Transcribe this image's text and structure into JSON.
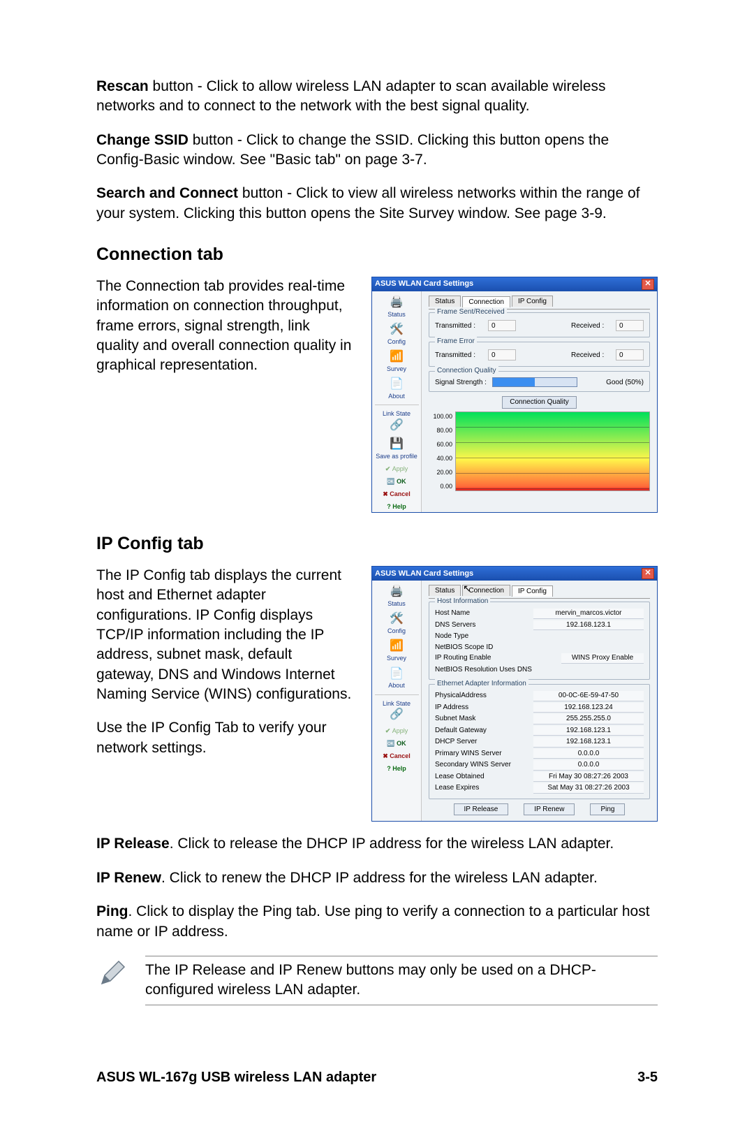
{
  "body": {
    "p1_bold": "Rescan",
    "p1_rest": " button - Click to allow wireless LAN adapter to scan available wireless networks and to connect to the network with the best signal quality.",
    "p2_bold": "Change SSID",
    "p2_rest": " button - Click to change the SSID. Clicking this button opens the Config-Basic window. See \"Basic tab\" on page 3-7.",
    "p3_bold": "Search and Connect",
    "p3_rest": " button - Click to view all wireless networks within the range of your system. Clicking this button opens the Site Survey window. See page 3-9.",
    "h_conn": "Connection tab",
    "conn_para": "The Connection tab provides real-time information on connection throughput, frame errors, signal strength, link quality and overall connection quality in graphical representation.",
    "h_ip": "IP Config tab",
    "ip_para1": "The IP Config tab displays the current host and Ethernet adapter configurations. IP Config displays TCP/IP information including the IP address, subnet mask, default gateway, DNS and Windows Internet Naming Service (WINS) configurations.",
    "ip_para2": "Use the IP Config Tab to verify your network settings.",
    "iprel_bold": "IP Release",
    "iprel_rest": ". Click to release the DHCP IP address for the wireless LAN adapter.",
    "ipren_bold": "IP Renew",
    "ipren_rest": ". Click to renew the DHCP IP address for the wireless LAN adapter.",
    "ping_bold": "Ping",
    "ping_rest": ". Click to display the Ping tab. Use ping to verify a connection to a particular host name or IP address.",
    "note": "The IP Release and IP Renew buttons may only be used on a DHCP-configured wireless LAN adapter."
  },
  "dialog_common": {
    "title": "ASUS WLAN Card Settings",
    "sidebar": {
      "status": "Status",
      "config": "Config",
      "survey": "Survey",
      "about": "About",
      "linkstate": "Link State",
      "saveprofile": "Save as profile",
      "apply": "Apply",
      "ok": "OK",
      "cancel": "Cancel",
      "help": "Help"
    }
  },
  "conn_dialog": {
    "tabs": {
      "status": "Status",
      "connection": "Connection",
      "ipconfig": "IP Config"
    },
    "frame_sent_title": "Frame Sent/Received",
    "frame_error_title": "Frame Error",
    "conn_quality_title": "Connection Quality",
    "transmitted_lbl": "Transmitted :",
    "received_lbl": "Received :",
    "tx_val": "0",
    "rx_val": "0",
    "err_tx_val": "0",
    "err_rx_val": "0",
    "signal_lbl": "Signal Strength :",
    "signal_text": "Good (50%)",
    "chart_title": "Connection Quality",
    "yaxis": [
      "100.00",
      "80.00",
      "60.00",
      "40.00",
      "20.00",
      "0.00"
    ]
  },
  "ip_dialog": {
    "tabs": {
      "status": "Status",
      "connection": "Connection",
      "ipconfig": "IP Config"
    },
    "host_box_title": "Host Information",
    "eth_box_title": "Ethernet Adapter Information",
    "host": {
      "hostname_lbl": "Host Name",
      "hostname_val": "mervin_marcos.victor",
      "dns_lbl": "DNS Servers",
      "dns_val": "192.168.123.1",
      "nodetype_lbl": "Node Type",
      "scope_lbl": "NetBIOS Scope ID",
      "iprouting_lbl": "IP Routing Enable",
      "winsproxy_lbl": "WINS Proxy Enable",
      "nbdns_lbl": "NetBIOS Resolution Uses DNS"
    },
    "eth": {
      "phys_lbl": "PhysicalAddress",
      "phys_val": "00-0C-6E-59-47-50",
      "ipaddr_lbl": "IP Address",
      "ipaddr_val": "192.168.123.24",
      "subnet_lbl": "Subnet Mask",
      "subnet_val": "255.255.255.0",
      "gateway_lbl": "Default Gateway",
      "gateway_val": "192.168.123.1",
      "dhcp_lbl": "DHCP Server",
      "dhcp_val": "192.168.123.1",
      "pwins_lbl": "Primary WINS Server",
      "pwins_val": "0.0.0.0",
      "swins_lbl": "Secondary WINS Server",
      "swins_val": "0.0.0.0",
      "leaseobt_lbl": "Lease Obtained",
      "leaseobt_val": "Fri May 30 08:27:26 2003",
      "leaseexp_lbl": "Lease Expires",
      "leaseexp_val": "Sat May 31 08:27:26 2003"
    },
    "buttons": {
      "iprelease": "IP Release",
      "iprenew": "IP Renew",
      "ping": "Ping"
    }
  },
  "footer": {
    "left": "ASUS WL-167g USB wireless LAN adapter",
    "right": "3-5"
  },
  "chart_data": {
    "type": "area",
    "title": "Connection Quality",
    "ylabel": "",
    "ylim": [
      0,
      100
    ],
    "yticks": [
      0,
      20,
      40,
      60,
      80,
      100
    ],
    "note": "Background is a full-width vertical gradient from green (100) through yellow (~40) to red (0); horizontal dashed gridlines at each tick. No plotted series line is visible yet."
  }
}
